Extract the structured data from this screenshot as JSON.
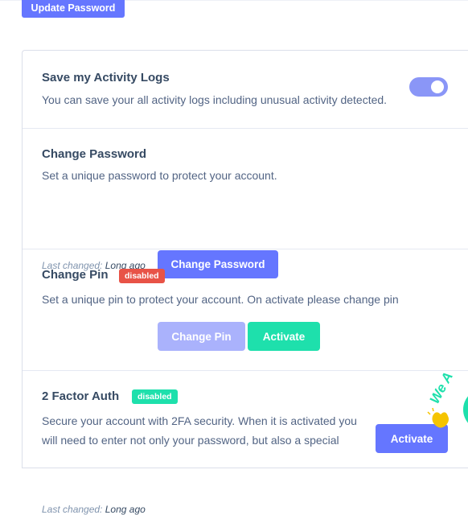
{
  "top": {
    "update_password_label": "Update Password"
  },
  "activity": {
    "title": "Save my Activity Logs",
    "desc": "You can save your all activity logs including unusual activity detected.",
    "toggle_on": true
  },
  "change_password": {
    "title": "Change Password",
    "desc": "Set a unique password to protect your account.",
    "meta_label": "Last changed:",
    "meta_value": "Long ago",
    "button": "Change Password"
  },
  "change_pin": {
    "title": "Change Pin",
    "badge": "disabled",
    "desc": "Set a unique pin to protect your account. On activate please change pin",
    "meta_label": "Last changed:",
    "meta_value": "Long ago",
    "button": "Change Pin",
    "activate": "Activate"
  },
  "two_factor": {
    "title": "2 Factor Auth",
    "badge": "disabled",
    "desc_line1": "Secure your account with 2FA security. When it is activated you",
    "desc_line2": "will need to enter not only your password, but also a special",
    "activate": "Activate"
  },
  "welcome_badge": {
    "text": "We A",
    "icon": "waving-hand-icon"
  },
  "colors": {
    "primary": "#6576ff",
    "primary_disabled": "#aab2fc",
    "success": "#1ee0ac",
    "danger": "#e85347"
  }
}
